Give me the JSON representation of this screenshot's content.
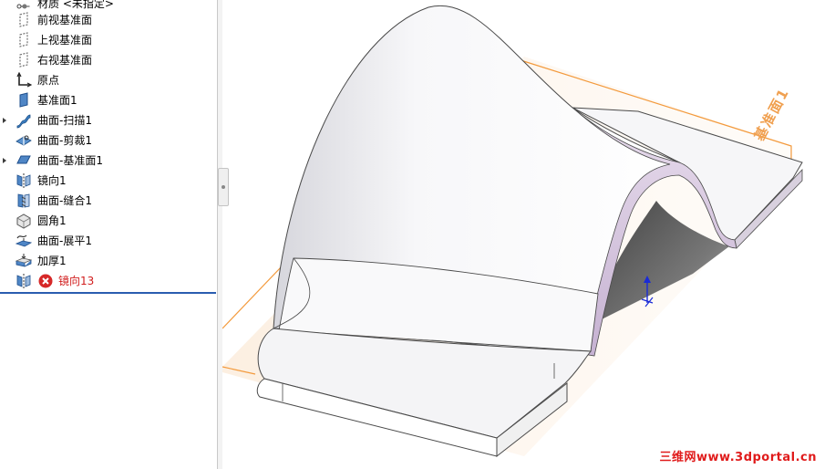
{
  "feature_tree": {
    "items": [
      {
        "label": "材质 <未指定>",
        "icon": "material-icon",
        "expandable": false
      },
      {
        "label": "前视基准面",
        "icon": "plane-icon",
        "expandable": false
      },
      {
        "label": "上视基准面",
        "icon": "plane-icon",
        "expandable": false
      },
      {
        "label": "右视基准面",
        "icon": "plane-icon",
        "expandable": false
      },
      {
        "label": "原点",
        "icon": "origin-icon",
        "expandable": false
      },
      {
        "label": "基准面1",
        "icon": "plane-solid-icon",
        "expandable": false
      },
      {
        "label": "曲面-扫描1",
        "icon": "surface-sweep-icon",
        "expandable": true
      },
      {
        "label": "曲面-剪裁1",
        "icon": "surface-trim-icon",
        "expandable": false
      },
      {
        "label": "曲面-基准面1",
        "icon": "planar-surface-icon",
        "expandable": true
      },
      {
        "label": "镜向1",
        "icon": "mirror-icon",
        "expandable": false
      },
      {
        "label": "曲面-缝合1",
        "icon": "knit-icon",
        "expandable": false
      },
      {
        "label": "圆角1",
        "icon": "fillet-icon",
        "expandable": false
      },
      {
        "label": "曲面-展平1",
        "icon": "flatten-icon",
        "expandable": false
      },
      {
        "label": "加厚1",
        "icon": "thicken-icon",
        "expandable": false
      },
      {
        "label": "镜向13",
        "icon": "mirror-icon",
        "expandable": false,
        "error": true
      }
    ]
  },
  "viewport": {
    "plane_label": "基准面1",
    "watermark": "三维网www.3dportal.cn"
  },
  "colors": {
    "plane_orange": "#f39a3c",
    "error_red": "#d11d1d",
    "rollback_blue": "#2a5db0",
    "watermark_red": "#e01b1b",
    "edge_purple": "#c9b6d4"
  }
}
